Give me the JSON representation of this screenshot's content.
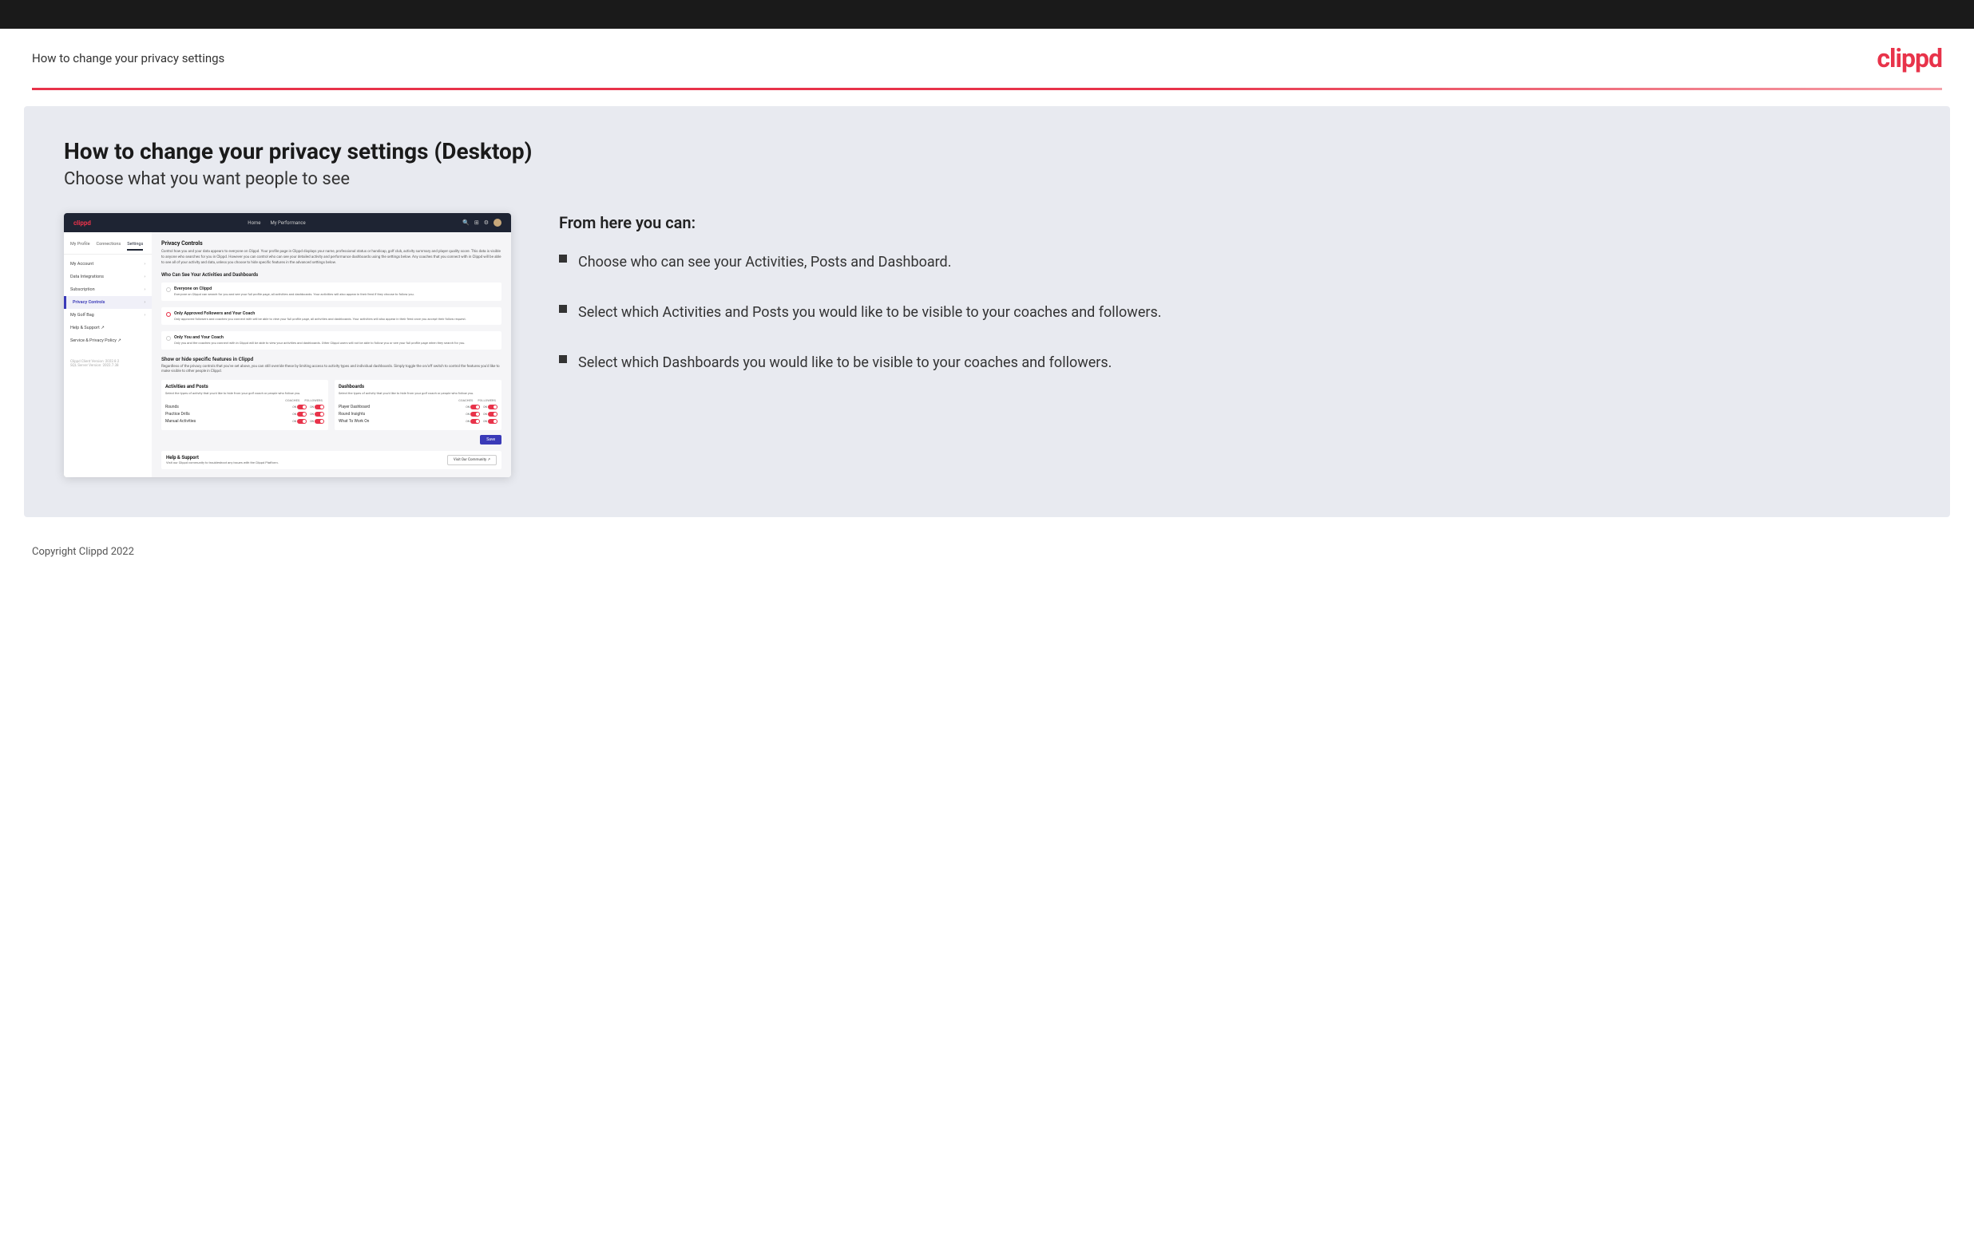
{
  "header": {
    "title": "How to change your privacy settings",
    "logo": "clippd"
  },
  "main": {
    "heading": "How to change your privacy settings (Desktop)",
    "subheading": "Choose what you want people to see",
    "from_here": {
      "title": "From here you can:",
      "bullets": [
        "Choose who can see your Activities, Posts and Dashboard.",
        "Select which Activities and Posts you would like to be visible to your coaches and followers.",
        "Select which Dashboards you would like to be visible to your coaches and followers."
      ]
    }
  },
  "mockup": {
    "navbar": {
      "logo": "clippd",
      "links": [
        "Home",
        "My Performance"
      ],
      "icons": [
        "search",
        "grid",
        "settings",
        "avatar"
      ]
    },
    "sidebar": {
      "tabs": [
        "My Profile",
        "Connections",
        "Settings"
      ],
      "active_tab": "Settings",
      "items": [
        {
          "label": "My Account",
          "active": false
        },
        {
          "label": "Data Integrations",
          "active": false
        },
        {
          "label": "Subscription",
          "active": false
        },
        {
          "label": "Privacy Controls",
          "active": true
        },
        {
          "label": "My Golf Bag",
          "active": false
        },
        {
          "label": "Help & Support",
          "active": false
        },
        {
          "label": "Service & Privacy Policy",
          "active": false
        }
      ],
      "version": "Clippd Client Version: 2022.8.2\nSQL Server Version: 2022.7.38"
    },
    "main_panel": {
      "section_title": "Privacy Controls",
      "section_desc": "Control how you and your data appears to everyone on Clippd. Your profile page in Clippd displays your name, professional status or handicap, golf club, activity summary and player quality score. This data is visible to anyone who searches for you in Clippd. However you can control who can see your detailed activity and performance dashboards using the settings below. Any coaches that you connect with in Clippd will be able to see all of your activity and data, unless you choose to hide specific features in the advanced settings below.",
      "who_can_see_title": "Who Can See Your Activities and Dashboards",
      "options": [
        {
          "label": "Everyone on Clippd",
          "desc": "Everyone on Clippd can search for you and see your full profile page, all activities and dashboards. Your activities will also appear in their feed if they choose to follow you.",
          "selected": false
        },
        {
          "label": "Only Approved Followers and Your Coach",
          "desc": "Only approved followers and coaches you connect with will be able to view your full profile page, all activities and dashboards. Your activities will also appear in their feed once you accept their follow request.",
          "selected": true
        },
        {
          "label": "Only You and Your Coach",
          "desc": "Only you and the coaches you connect with in Clippd will be able to view your activities and dashboards. Other Clippd users will not be able to follow you or see your full profile page when they search for you.",
          "selected": false
        }
      ],
      "show_hide_title": "Show or hide specific features in Clippd",
      "show_hide_desc": "Regardless of the privacy controls that you've set above, you can still override these by limiting access to activity types and individual dashboards. Simply toggle the on/off switch to control the features you'd like to make visible to other people in Clippd.",
      "activities_table": {
        "title": "Activities and Posts",
        "desc": "Select the types of activity that you'd like to hide from your golf coach or people who follow you.",
        "columns": [
          "COACHES",
          "FOLLOWERS"
        ],
        "rows": [
          {
            "label": "Rounds",
            "coaches_on": true,
            "followers_on": true
          },
          {
            "label": "Practice Drills",
            "coaches_on": true,
            "followers_on": true
          },
          {
            "label": "Manual Activities",
            "coaches_on": true,
            "followers_on": true
          }
        ]
      },
      "dashboards_table": {
        "title": "Dashboards",
        "desc": "Select the types of activity that you'd like to hide from your golf coach or people who follow you.",
        "columns": [
          "COACHES",
          "FOLLOWERS"
        ],
        "rows": [
          {
            "label": "Player Dashboard",
            "coaches_on": true,
            "followers_on": true
          },
          {
            "label": "Round Insights",
            "coaches_on": true,
            "followers_on": true
          },
          {
            "label": "What To Work On",
            "coaches_on": true,
            "followers_on": true
          }
        ]
      },
      "save_label": "Save",
      "help": {
        "title": "Help & Support",
        "desc": "Visit our Clippd community to troubleshoot any issues with the Clippd Platform.",
        "button": "Visit Our Community"
      }
    }
  },
  "footer": {
    "copyright": "Copyright Clippd 2022"
  }
}
